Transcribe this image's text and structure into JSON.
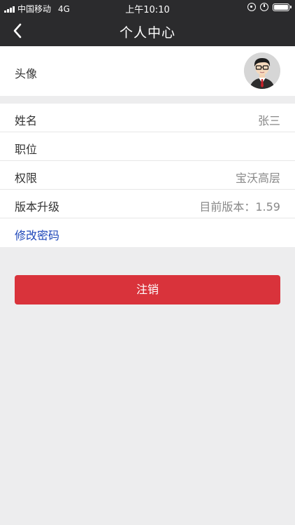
{
  "status_bar": {
    "carrier": "中国移动",
    "network": "4G",
    "time": "上午10:10"
  },
  "nav": {
    "title": "个人中心",
    "back_icon": "chevron-left-icon"
  },
  "profile": {
    "avatar_label": "头像",
    "rows": [
      {
        "label": "姓名",
        "value": "张三"
      },
      {
        "label": "职位",
        "value": ""
      },
      {
        "label": "权限",
        "value": "宝沃高层"
      },
      {
        "label": "版本升级",
        "value": "目前版本：1.59"
      }
    ],
    "change_password": "修改密码"
  },
  "logout_label": "注销",
  "colors": {
    "nav_bg": "#2b2b2d",
    "page_bg": "#ededee",
    "logout_bg": "#d9333b",
    "link": "#1d46b8"
  }
}
